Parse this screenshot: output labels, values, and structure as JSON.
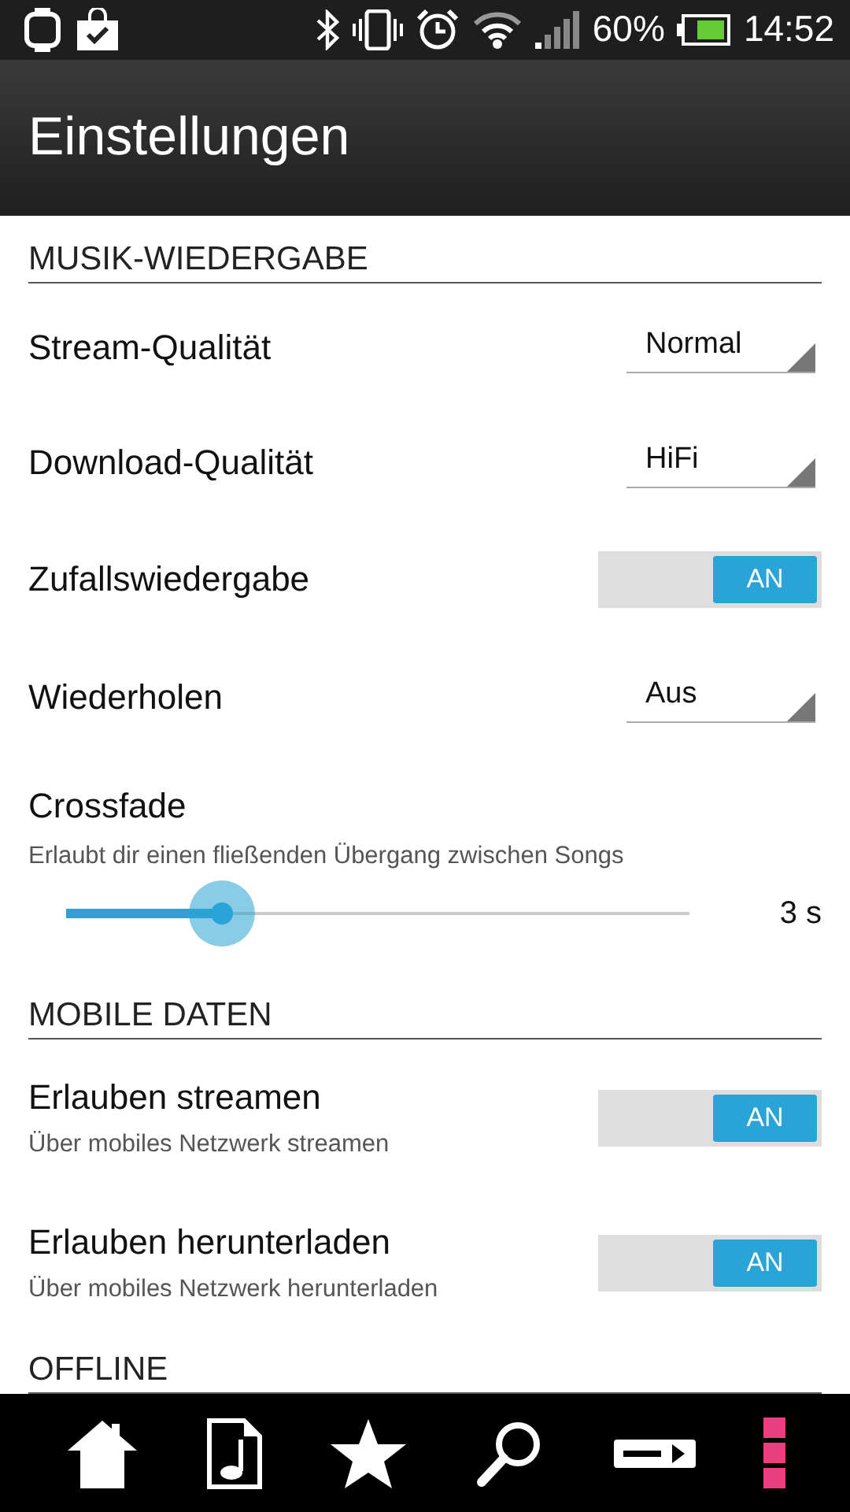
{
  "status_bar": {
    "battery_text": "60%",
    "time": "14:52"
  },
  "header": {
    "title": "Einstellungen"
  },
  "sections": [
    {
      "title": "MUSIK-WIEDERGABE",
      "items": [
        {
          "kind": "dropdown",
          "label": "Stream-Qualität",
          "value": "Normal"
        },
        {
          "kind": "dropdown",
          "label": "Download-Qualität",
          "value": "HiFi"
        },
        {
          "kind": "toggle",
          "label": "Zufallswiedergabe",
          "on": true,
          "on_text": "AN"
        },
        {
          "kind": "dropdown",
          "label": "Wiederholen",
          "value": "Aus"
        },
        {
          "kind": "slider",
          "label": "Crossfade",
          "description": "Erlaubt dir einen fließenden Übergang zwischen Songs",
          "level": 0.25,
          "reading": "3 s"
        }
      ]
    },
    {
      "title": "MOBILE DATEN",
      "items": [
        {
          "kind": "toggle",
          "label": "Erlauben streamen",
          "description": "Über mobiles Netzwerk streamen",
          "on": true,
          "on_text": "AN"
        },
        {
          "kind": "toggle",
          "label": "Erlauben herunterladen",
          "description": "Über mobiles Netzwerk herunterladen",
          "on": true,
          "on_text": "AN"
        }
      ]
    },
    {
      "title": "OFFLINE"
    }
  ]
}
